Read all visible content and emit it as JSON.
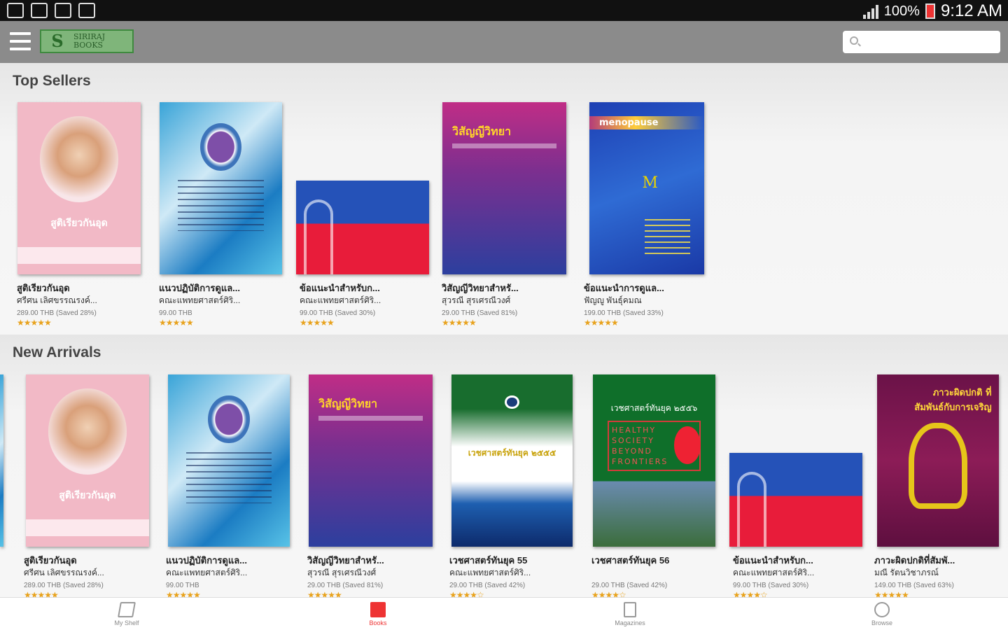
{
  "status_bar": {
    "battery": "100%",
    "time": "9:12 AM"
  },
  "app_bar": {
    "logo_line1": "SIRIRAJ",
    "logo_line2": "BOOKS",
    "search_placeholder": ""
  },
  "sections": {
    "top": {
      "title": "Top Sellers",
      "books": [
        {
          "title": "สูติเรียวกันอุด",
          "author": "ศรีศน เลิศขรรณรงค์...",
          "price": "289.00 THB (Saved 28%)",
          "rating": 5
        },
        {
          "title": "แนวปฏิบัติการดูแล...",
          "author": "คณะแพทยศาสตร์ศิริ...",
          "price": "99.00 THB",
          "rating": 5
        },
        {
          "title": "ข้อแนะนำสำหรับก...",
          "author": "คณะแพทยศาสตร์ศิริ...",
          "price": "99.00 THB (Saved 30%)",
          "rating": 5
        },
        {
          "title": "วิสัญญีวิทยาสำหรั...",
          "author": "สุวรณี สุรเศรณีวงศ์",
          "price": "29.00 THB (Saved 81%)",
          "rating": 5
        },
        {
          "title": "ข้อแนะนำการดูแล...",
          "author": "ฟัญญู พันธุ์คมณ",
          "price": "199.00 THB (Saved 33%)",
          "rating": 5
        }
      ]
    },
    "new": {
      "title": "New Arrivals",
      "books": [
        {
          "title": "สูติเรียวกันอุด",
          "author": "ศรีศน เลิศขรรณรงค์...",
          "price": "289.00 THB (Saved 28%)",
          "rating": 5
        },
        {
          "title": "แนวปฏิบัติการดูแล...",
          "author": "คณะแพทยศาสตร์ศิริ...",
          "price": "99.00 THB",
          "rating": 5
        },
        {
          "title": "วิสัญญีวิทยาสำหรั...",
          "author": "สุวรณี สุรเศรณีวงศ์",
          "price": "29.00 THB (Saved 81%)",
          "rating": 5
        },
        {
          "title": "เวชศาสตร์ทันยุค 55",
          "author": "คณะแพทยศาสตร์ศิริ...",
          "price": "29.00 THB (Saved 42%)",
          "rating": 4
        },
        {
          "title": "เวชศาสตร์ทันยุค 56",
          "author": "",
          "price": "29.00 THB (Saved 42%)",
          "rating": 4
        },
        {
          "title": "ข้อแนะนำสำหรับก...",
          "author": "คณะแพทยศาสตร์ศิริ...",
          "price": "99.00 THB (Saved 30%)",
          "rating": 4
        },
        {
          "title": "ภาวะผิดปกติที่สัมพั...",
          "author": "มณี รัตนวิชาภรณ์",
          "price": "149.00 THB (Saved 63%)",
          "rating": 5
        }
      ]
    }
  },
  "covers": {
    "pink_title": "สูติเรียวกันอุด",
    "magenta_title": "วิสัญญีวิทยา",
    "meno_title": "menopause",
    "meno_letter": "M",
    "green_title": "เวชศาสตร์ทันยุค ๒๕๕๕",
    "green2_title": "เวชศาสตร์ทันยุค ๒๕๕๖",
    "green2_box": "HEALTHY SOCIETY BEYOND FRONTIERS",
    "plum_title": "ภาวะผิดปกติ ที่สัมพันธ์กับการเจริญ"
  },
  "bottom_nav": [
    {
      "label": "My Shelf",
      "icon": "shelf-icon",
      "active": false
    },
    {
      "label": "Books",
      "icon": "books-icon",
      "active": true
    },
    {
      "label": "Magazines",
      "icon": "magazine-icon",
      "active": false
    },
    {
      "label": "Browse",
      "icon": "globe-icon",
      "active": false
    }
  ],
  "colors": {
    "accent": "#e33333",
    "app_bar": "#8b8b8b",
    "stars": "#e8a21c"
  }
}
